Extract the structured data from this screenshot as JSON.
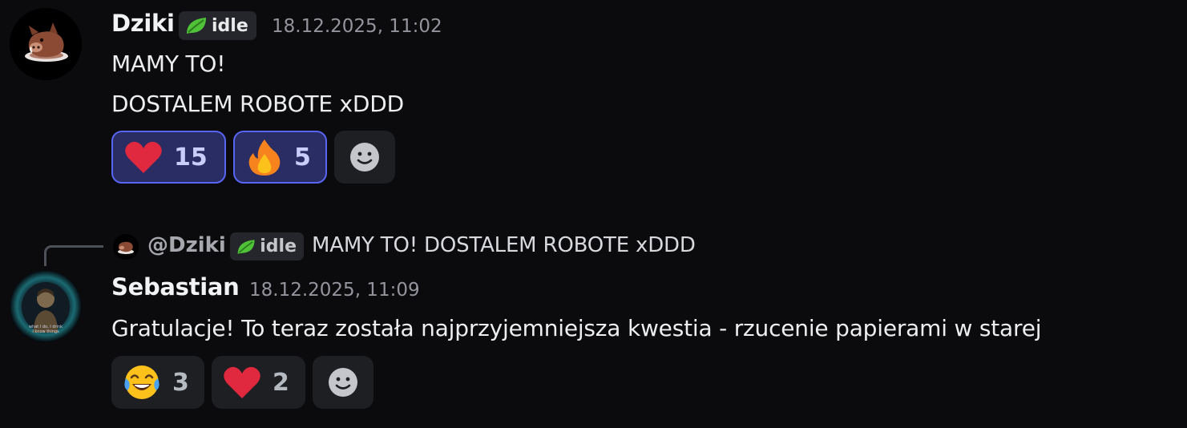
{
  "messages": [
    {
      "author": "Dziki",
      "tag": "idle",
      "timestamp": "18.12.2025, 11:02",
      "lines": [
        "MAMY TO!",
        "DOSTALEM ROBOTE xDDD"
      ],
      "reactions": [
        {
          "emoji": "heart-emoji",
          "count": "15",
          "active": true
        },
        {
          "emoji": "fire-emoji",
          "count": "5",
          "active": true
        }
      ]
    },
    {
      "reply": {
        "mention": "@Dziki",
        "tag": "idle",
        "text": "MAMY TO! DOSTALEM ROBOTE xDDD"
      },
      "author": "Sebastian",
      "timestamp": "18.12.2025, 11:09",
      "lines": [
        "Gratulacje! To teraz została najprzyjemniejsza kwestia - rzucenie papierami w starej"
      ],
      "reactions": [
        {
          "emoji": "joy-emoji",
          "count": "3",
          "active": false
        },
        {
          "emoji": "heart-emoji",
          "count": "2",
          "active": false
        }
      ]
    }
  ],
  "colors": {
    "background": "#0b0b0e",
    "active_reaction_border": "#5865f2",
    "active_reaction_fill": "#2a2d63",
    "heart": "#e0283f",
    "tag_leaf": "#4fc238"
  }
}
